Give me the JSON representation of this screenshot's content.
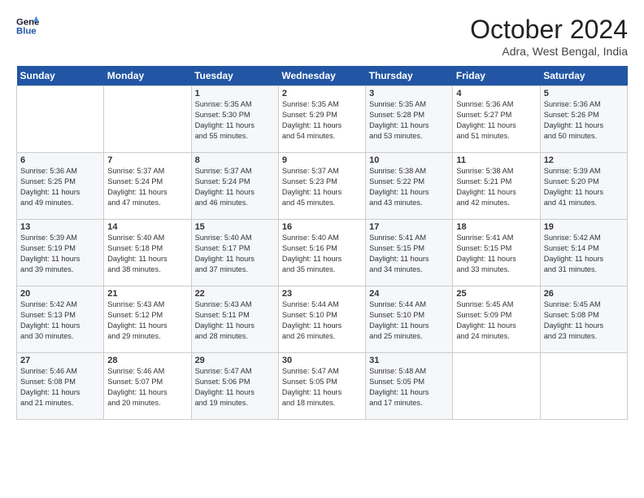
{
  "header": {
    "logo_line1": "General",
    "logo_line2": "Blue",
    "month": "October 2024",
    "location": "Adra, West Bengal, India"
  },
  "weekdays": [
    "Sunday",
    "Monday",
    "Tuesday",
    "Wednesday",
    "Thursday",
    "Friday",
    "Saturday"
  ],
  "weeks": [
    [
      {
        "day": "",
        "info": ""
      },
      {
        "day": "",
        "info": ""
      },
      {
        "day": "1",
        "info": "Sunrise: 5:35 AM\nSunset: 5:30 PM\nDaylight: 11 hours\nand 55 minutes."
      },
      {
        "day": "2",
        "info": "Sunrise: 5:35 AM\nSunset: 5:29 PM\nDaylight: 11 hours\nand 54 minutes."
      },
      {
        "day": "3",
        "info": "Sunrise: 5:35 AM\nSunset: 5:28 PM\nDaylight: 11 hours\nand 53 minutes."
      },
      {
        "day": "4",
        "info": "Sunrise: 5:36 AM\nSunset: 5:27 PM\nDaylight: 11 hours\nand 51 minutes."
      },
      {
        "day": "5",
        "info": "Sunrise: 5:36 AM\nSunset: 5:26 PM\nDaylight: 11 hours\nand 50 minutes."
      }
    ],
    [
      {
        "day": "6",
        "info": "Sunrise: 5:36 AM\nSunset: 5:25 PM\nDaylight: 11 hours\nand 49 minutes."
      },
      {
        "day": "7",
        "info": "Sunrise: 5:37 AM\nSunset: 5:24 PM\nDaylight: 11 hours\nand 47 minutes."
      },
      {
        "day": "8",
        "info": "Sunrise: 5:37 AM\nSunset: 5:24 PM\nDaylight: 11 hours\nand 46 minutes."
      },
      {
        "day": "9",
        "info": "Sunrise: 5:37 AM\nSunset: 5:23 PM\nDaylight: 11 hours\nand 45 minutes."
      },
      {
        "day": "10",
        "info": "Sunrise: 5:38 AM\nSunset: 5:22 PM\nDaylight: 11 hours\nand 43 minutes."
      },
      {
        "day": "11",
        "info": "Sunrise: 5:38 AM\nSunset: 5:21 PM\nDaylight: 11 hours\nand 42 minutes."
      },
      {
        "day": "12",
        "info": "Sunrise: 5:39 AM\nSunset: 5:20 PM\nDaylight: 11 hours\nand 41 minutes."
      }
    ],
    [
      {
        "day": "13",
        "info": "Sunrise: 5:39 AM\nSunset: 5:19 PM\nDaylight: 11 hours\nand 39 minutes."
      },
      {
        "day": "14",
        "info": "Sunrise: 5:40 AM\nSunset: 5:18 PM\nDaylight: 11 hours\nand 38 minutes."
      },
      {
        "day": "15",
        "info": "Sunrise: 5:40 AM\nSunset: 5:17 PM\nDaylight: 11 hours\nand 37 minutes."
      },
      {
        "day": "16",
        "info": "Sunrise: 5:40 AM\nSunset: 5:16 PM\nDaylight: 11 hours\nand 35 minutes."
      },
      {
        "day": "17",
        "info": "Sunrise: 5:41 AM\nSunset: 5:15 PM\nDaylight: 11 hours\nand 34 minutes."
      },
      {
        "day": "18",
        "info": "Sunrise: 5:41 AM\nSunset: 5:15 PM\nDaylight: 11 hours\nand 33 minutes."
      },
      {
        "day": "19",
        "info": "Sunrise: 5:42 AM\nSunset: 5:14 PM\nDaylight: 11 hours\nand 31 minutes."
      }
    ],
    [
      {
        "day": "20",
        "info": "Sunrise: 5:42 AM\nSunset: 5:13 PM\nDaylight: 11 hours\nand 30 minutes."
      },
      {
        "day": "21",
        "info": "Sunrise: 5:43 AM\nSunset: 5:12 PM\nDaylight: 11 hours\nand 29 minutes."
      },
      {
        "day": "22",
        "info": "Sunrise: 5:43 AM\nSunset: 5:11 PM\nDaylight: 11 hours\nand 28 minutes."
      },
      {
        "day": "23",
        "info": "Sunrise: 5:44 AM\nSunset: 5:10 PM\nDaylight: 11 hours\nand 26 minutes."
      },
      {
        "day": "24",
        "info": "Sunrise: 5:44 AM\nSunset: 5:10 PM\nDaylight: 11 hours\nand 25 minutes."
      },
      {
        "day": "25",
        "info": "Sunrise: 5:45 AM\nSunset: 5:09 PM\nDaylight: 11 hours\nand 24 minutes."
      },
      {
        "day": "26",
        "info": "Sunrise: 5:45 AM\nSunset: 5:08 PM\nDaylight: 11 hours\nand 23 minutes."
      }
    ],
    [
      {
        "day": "27",
        "info": "Sunrise: 5:46 AM\nSunset: 5:08 PM\nDaylight: 11 hours\nand 21 minutes."
      },
      {
        "day": "28",
        "info": "Sunrise: 5:46 AM\nSunset: 5:07 PM\nDaylight: 11 hours\nand 20 minutes."
      },
      {
        "day": "29",
        "info": "Sunrise: 5:47 AM\nSunset: 5:06 PM\nDaylight: 11 hours\nand 19 minutes."
      },
      {
        "day": "30",
        "info": "Sunrise: 5:47 AM\nSunset: 5:05 PM\nDaylight: 11 hours\nand 18 minutes."
      },
      {
        "day": "31",
        "info": "Sunrise: 5:48 AM\nSunset: 5:05 PM\nDaylight: 11 hours\nand 17 minutes."
      },
      {
        "day": "",
        "info": ""
      },
      {
        "day": "",
        "info": ""
      }
    ]
  ]
}
